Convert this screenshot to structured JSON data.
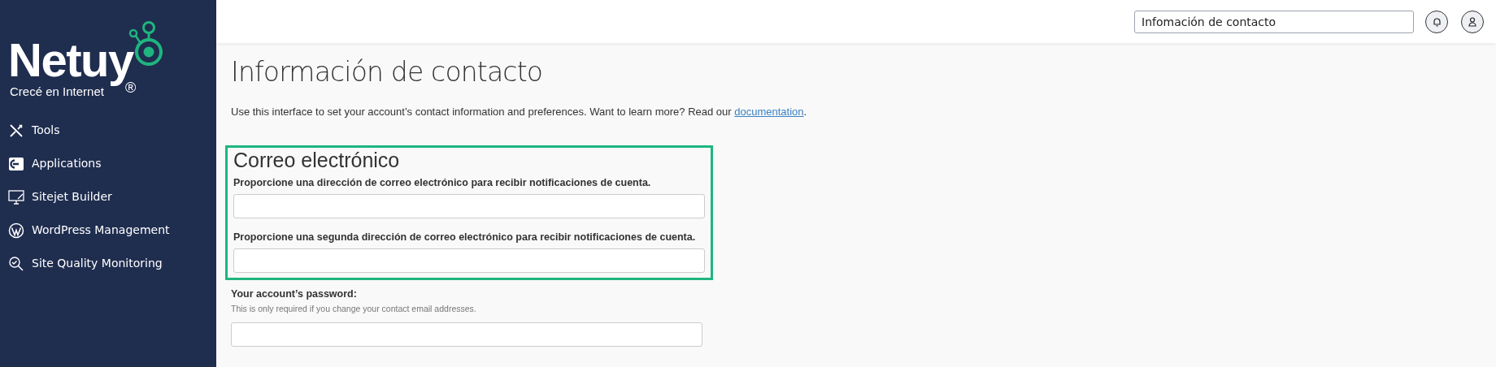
{
  "sidebar": {
    "logo": {
      "name": "Netuy",
      "tagline": "Crecé en Internet",
      "mark": "®"
    },
    "items": [
      {
        "label": "Tools"
      },
      {
        "label": "Applications"
      },
      {
        "label": "Sitejet Builder"
      },
      {
        "label": "WordPress Management"
      },
      {
        "label": "Site Quality Monitoring"
      }
    ]
  },
  "header": {
    "search": {
      "value": "Infomación de contacto"
    }
  },
  "page": {
    "title": "Información de contacto",
    "description": {
      "text": "Use this interface to set your account’s contact information and preferences. Want to learn more? Read our ",
      "link": "documentation",
      "after": "."
    },
    "email_section": {
      "title": "Correo electrónico",
      "highlighted": true,
      "fields": [
        {
          "label": "Proporcione una dirección de correo electrónico para recibir notificaciones de cuenta."
        },
        {
          "label": "Proporcione una segunda dirección de correo electrónico para recibir notificaciones de cuenta."
        }
      ]
    },
    "password": {
      "label": "Your account’s password:",
      "help": "This is only required if you change your contact email addresses."
    }
  }
}
